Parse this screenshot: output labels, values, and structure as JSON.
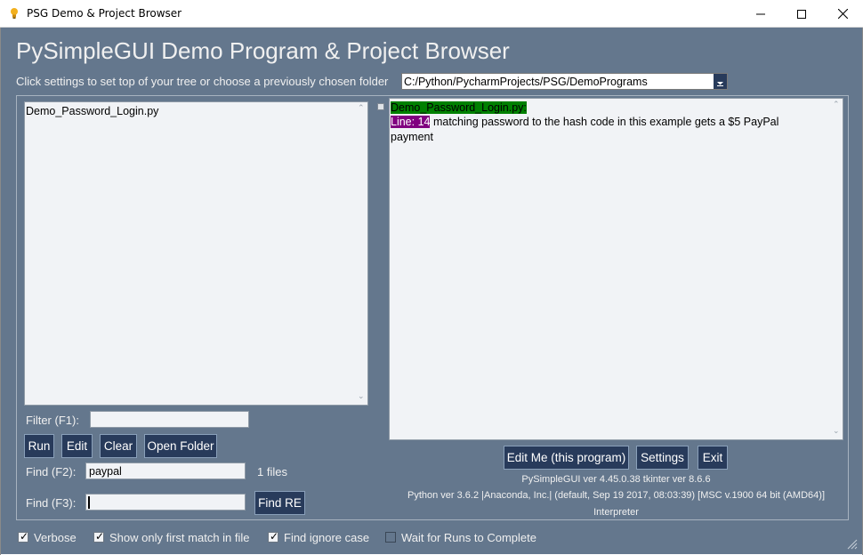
{
  "window": {
    "title": "PSG Demo & Project Browser",
    "icons": {
      "app": "bulb-icon",
      "minimize": "minimize-icon",
      "maximize": "maximize-icon",
      "close": "close-icon"
    }
  },
  "header": {
    "title": "PySimpleGUI Demo Program & Project Browser",
    "prompt": "Click settings to set top of your tree or choose a previously chosen folder"
  },
  "folder": {
    "value": "C:/Python/PycharmProjects/PSG/DemoPrograms"
  },
  "file_list": {
    "items": [
      "Demo_Password_Login.py"
    ]
  },
  "filter": {
    "label": "Filter (F1):",
    "value": ""
  },
  "buttons": {
    "run": "Run",
    "edit": "Edit",
    "clear": "Clear",
    "open_folder": "Open Folder",
    "find_re": "Find RE",
    "edit_me": "Edit Me (this program)",
    "settings": "Settings",
    "exit": "Exit"
  },
  "find": {
    "f2_label": "Find (F2):",
    "f2_value": "paypal",
    "count": "1 files",
    "f3_label": "Find (F3):",
    "f3_value": ""
  },
  "output": {
    "filename": "Demo_Password_Login.py:",
    "line_tag": "Line: 14",
    "text_1": " matching password to the hash code in this example gets a $5 PayPal",
    "text_2": "payment"
  },
  "info": {
    "versions": "PySimpleGUI ver 4.45.0.38  tkinter ver 8.6.6",
    "python": "Python ver 3.6.2 |Anaconda, Inc.| (default, Sep 19 2017, 08:03:39) [MSC v.1900 64 bit (AMD64)]",
    "interpreter": "Interpreter"
  },
  "options": [
    {
      "label": "Verbose",
      "checked": true
    },
    {
      "label": "Show only first match in file",
      "checked": true
    },
    {
      "label": "Find ignore case",
      "checked": true
    },
    {
      "label": "Wait for Runs to Complete",
      "checked": false
    }
  ],
  "colors": {
    "background": "#64778d",
    "button": "#283b5b",
    "file_highlight": "#008000",
    "line_highlight": "#800080"
  }
}
